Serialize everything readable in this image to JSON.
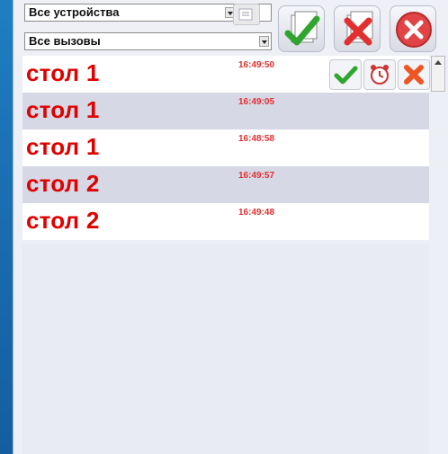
{
  "filters": {
    "devices": "Все устройства",
    "calls": "Все вызовы"
  },
  "calls": [
    {
      "title": "стол 1",
      "time": "16:49:50"
    },
    {
      "title": "стол 1",
      "time": "16:49:05"
    },
    {
      "title": "стол 1",
      "time": "16:48:58"
    },
    {
      "title": "стол 2",
      "time": "16:49:57"
    },
    {
      "title": "стол 2",
      "time": "16:49:48"
    }
  ],
  "colors": {
    "accent_red": "#e00000",
    "row_alt": "#d6d8e6",
    "ok_green": "#2fa52f",
    "cancel_red": "#e44"
  },
  "icons": {
    "toolbar_confirm": "confirm-all-icon",
    "toolbar_delete": "delete-all-icon",
    "toolbar_close": "close-icon",
    "row_ok": "checkmark-icon",
    "row_alarm": "alarm-clock-icon",
    "row_cancel": "cross-icon"
  }
}
